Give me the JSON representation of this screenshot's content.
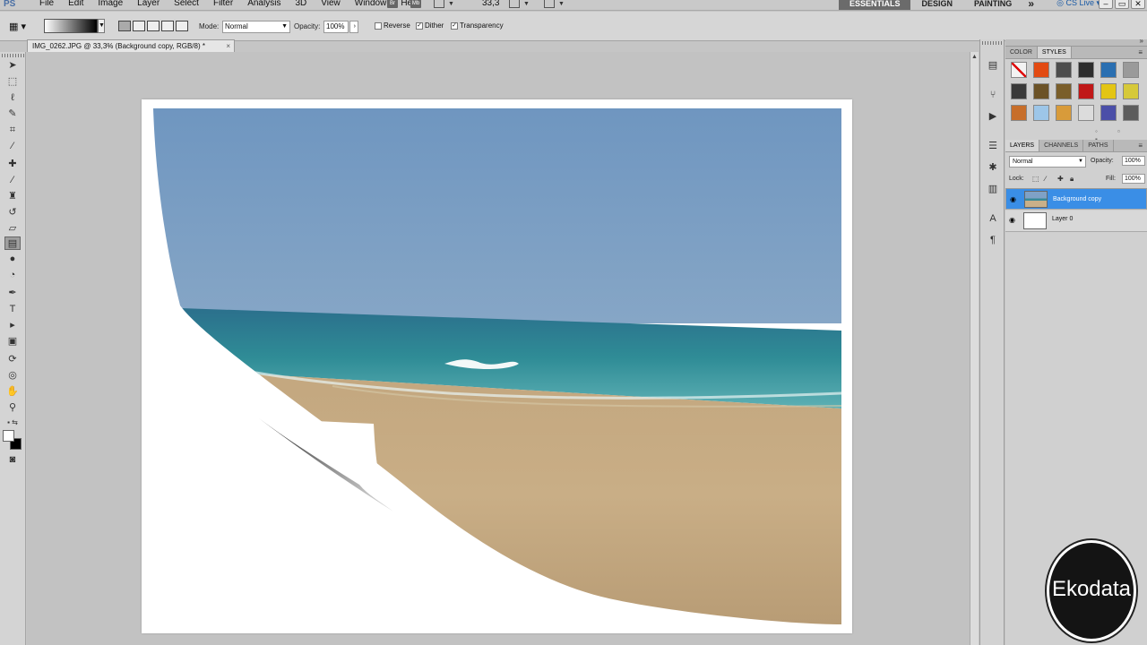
{
  "menubar": {
    "logo": "PS",
    "items": [
      "File",
      "Edit",
      "Image",
      "Layer",
      "Select",
      "Filter",
      "Analysis",
      "3D",
      "View",
      "Window",
      "Help"
    ],
    "zoom": "33,3",
    "workspaces": [
      "ESSENTIALS",
      "DESIGN",
      "PAINTING"
    ],
    "active_workspace": "ESSENTIALS",
    "cs_live": "CS Live"
  },
  "options": {
    "mode_label": "Mode:",
    "mode_value": "Normal",
    "opacity_label": "Opacity:",
    "opacity_value": "100%",
    "reverse": "Reverse",
    "dither": "Dither",
    "transparency": "Transparency"
  },
  "document": {
    "tab_title": "IMG_0262.JPG @ 33,3% (Background copy, RGB/8) *"
  },
  "panels": {
    "color_tab": "COLOR",
    "styles_tab": "STYLES",
    "layers_tab": "LAYERS",
    "channels_tab": "CHANNELS",
    "paths_tab": "PATHS",
    "blend_mode": "Normal",
    "opacity_label": "Opacity:",
    "opacity_value": "100%",
    "lock_label": "Lock:",
    "fill_label": "Fill:",
    "fill_value": "100%",
    "layers": [
      {
        "name": "Background copy",
        "selected": true
      },
      {
        "name": "Layer 0",
        "selected": false
      }
    ]
  },
  "style_swatches": [
    "#f3f3f3",
    "#e24a12",
    "#4c4c4c",
    "#2d2d2d",
    "#2a6fb1",
    "#9a9a9a",
    "#3a3a3a",
    "#6b5227",
    "#7a5e2a",
    "#c01818",
    "#e3c514",
    "#d6c93a",
    "#c76e2a",
    "#9dc6e8",
    "#d89b3a",
    "#dcdcdc",
    "#4b4fa8",
    "#5c5c5c"
  ],
  "watermark": "Ekodata"
}
